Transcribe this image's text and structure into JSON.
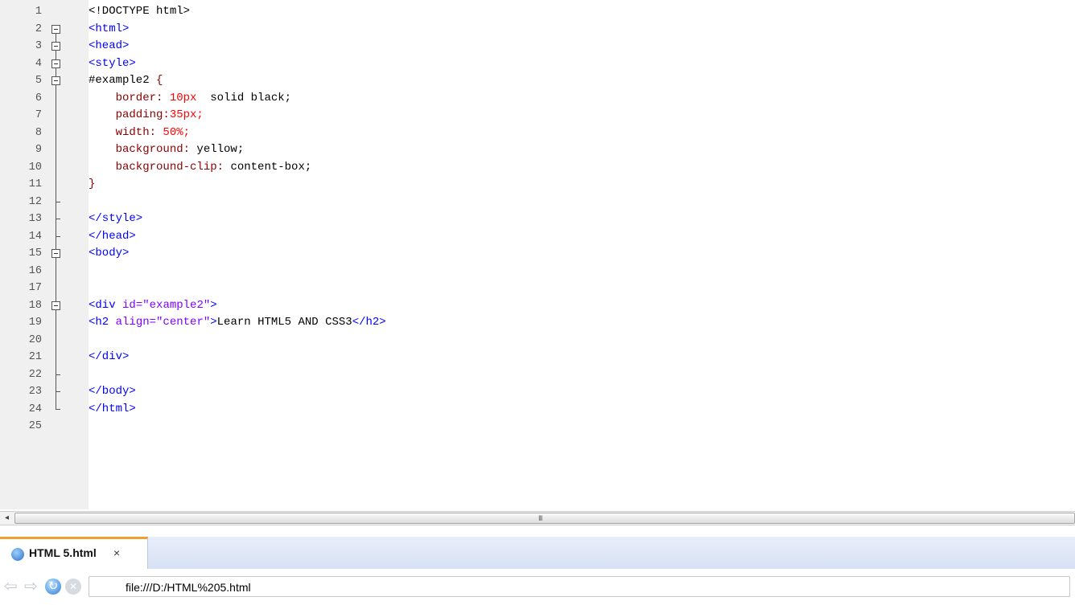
{
  "editor": {
    "lines": [
      {
        "n": "1",
        "parts": [
          {
            "t": "<!DOCTYPE html>",
            "c": "kw"
          }
        ]
      },
      {
        "n": "2",
        "parts": [
          {
            "t": "<html>",
            "c": "tag"
          }
        ]
      },
      {
        "n": "3",
        "parts": [
          {
            "t": "<head>",
            "c": "tag"
          }
        ]
      },
      {
        "n": "4",
        "parts": [
          {
            "t": "<style>",
            "c": "tag"
          }
        ]
      },
      {
        "n": "5",
        "parts": [
          {
            "t": "#example2 ",
            "c": "sel"
          },
          {
            "t": "{",
            "c": "prop"
          }
        ]
      },
      {
        "n": "6",
        "parts": [
          {
            "t": "    border: ",
            "c": "prop"
          },
          {
            "t": "10px",
            "c": "num"
          },
          {
            "t": "  solid black;",
            "c": "kw"
          }
        ]
      },
      {
        "n": "7",
        "parts": [
          {
            "t": "    padding:",
            "c": "prop"
          },
          {
            "t": "35px;",
            "c": "num"
          }
        ]
      },
      {
        "n": "8",
        "parts": [
          {
            "t": "    width: ",
            "c": "prop"
          },
          {
            "t": "50%;",
            "c": "num"
          }
        ]
      },
      {
        "n": "9",
        "parts": [
          {
            "t": "    background: ",
            "c": "prop"
          },
          {
            "t": "yellow;",
            "c": "kw"
          }
        ]
      },
      {
        "n": "10",
        "parts": [
          {
            "t": "    background-clip: ",
            "c": "prop"
          },
          {
            "t": "content-box;",
            "c": "kw"
          }
        ]
      },
      {
        "n": "11",
        "parts": [
          {
            "t": "}",
            "c": "prop"
          }
        ]
      },
      {
        "n": "12",
        "parts": []
      },
      {
        "n": "13",
        "parts": [
          {
            "t": "</style>",
            "c": "tag"
          }
        ]
      },
      {
        "n": "14",
        "parts": [
          {
            "t": "</head>",
            "c": "tag"
          }
        ]
      },
      {
        "n": "15",
        "parts": [
          {
            "t": "<body>",
            "c": "tag"
          }
        ]
      },
      {
        "n": "16",
        "parts": []
      },
      {
        "n": "17",
        "parts": []
      },
      {
        "n": "18",
        "parts": [
          {
            "t": "<div ",
            "c": "tag"
          },
          {
            "t": "id=",
            "c": "val"
          },
          {
            "t": "\"example2\"",
            "c": "val"
          },
          {
            "t": ">",
            "c": "tag"
          }
        ]
      },
      {
        "n": "19",
        "parts": [
          {
            "t": "<h2 ",
            "c": "tag"
          },
          {
            "t": "align=",
            "c": "val"
          },
          {
            "t": "\"center\"",
            "c": "val"
          },
          {
            "t": ">",
            "c": "tag"
          },
          {
            "t": "Learn HTML5 AND CSS3",
            "c": "kw"
          },
          {
            "t": "</h2>",
            "c": "tag"
          }
        ]
      },
      {
        "n": "20",
        "parts": []
      },
      {
        "n": "21",
        "parts": [
          {
            "t": "</div>",
            "c": "tag"
          }
        ]
      },
      {
        "n": "22",
        "parts": []
      },
      {
        "n": "23",
        "parts": [
          {
            "t": "</body>",
            "c": "tag"
          }
        ]
      },
      {
        "n": "24",
        "parts": [
          {
            "t": "</html>",
            "c": "tag"
          }
        ]
      },
      {
        "n": "25",
        "parts": []
      }
    ]
  },
  "scrollbar": {
    "left_arrow": "◂",
    "grip": "III"
  },
  "tab": {
    "label": "HTML 5.html",
    "close": "×",
    "icon": "globe-icon"
  },
  "nav": {
    "url": "file:///D:/HTML%205.html",
    "back_glyph": "⇦",
    "forward_glyph": "⇨",
    "reload_glyph": "↻",
    "stop_glyph": "✕"
  }
}
